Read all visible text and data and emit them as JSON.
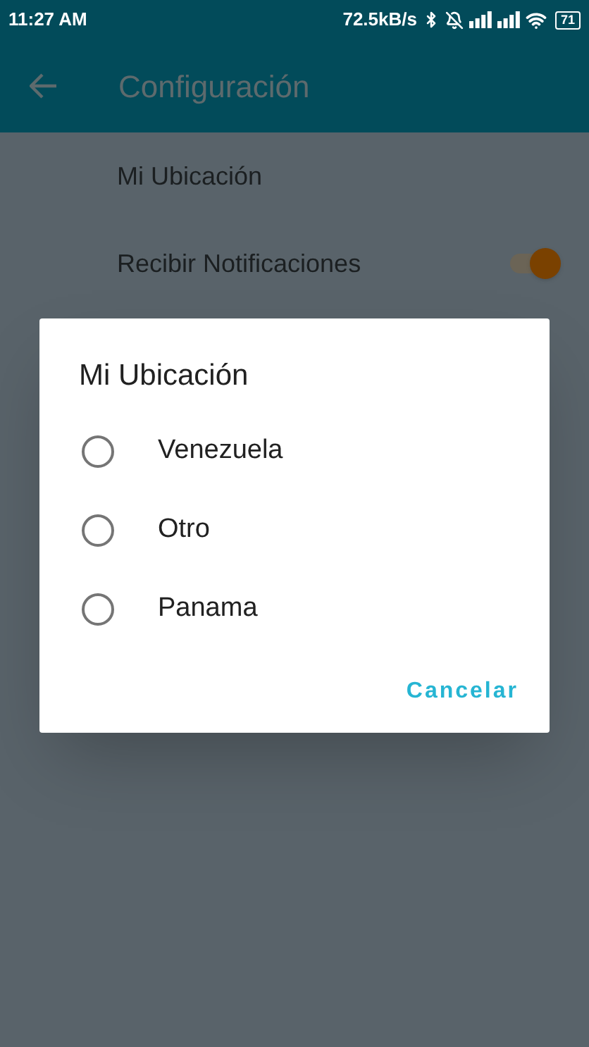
{
  "status_bar": {
    "time": "11:27 AM",
    "speed": "72.5kB/s",
    "battery": "71"
  },
  "app_bar": {
    "title": "Configuración"
  },
  "settings": [
    {
      "kind": "item",
      "label": "Mi Ubicación"
    },
    {
      "kind": "switch",
      "label": "Recibir Notificaciones",
      "on": true
    }
  ],
  "dialog": {
    "title": "Mi Ubicación",
    "options": [
      {
        "label": "Venezuela",
        "selected": false
      },
      {
        "label": "Otro",
        "selected": false
      },
      {
        "label": "Panama",
        "selected": false
      }
    ],
    "button": "Cancelar"
  }
}
